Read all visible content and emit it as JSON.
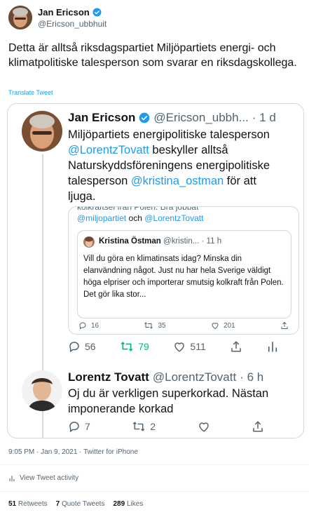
{
  "header": {
    "name": "Jan Ericson",
    "handle": "@Ericson_ubbhuit"
  },
  "tweet": {
    "text": "Detta är alltså riksdagspartiet Miljöpartiets energi- och klimatpolitiske talesperson som svarar en riksdagskollega.",
    "translate_label": "Translate Tweet"
  },
  "embed": {
    "author_name": "Jan Ericson",
    "author_handle": "@Ericson_ubbh...",
    "time": "· 1 d",
    "line1": "Miljöpartiets energipolitiske talesperson",
    "mention_lorentz": "@LorentzTovatt",
    "line2_rest": " beskyller alltså",
    "line3": "Naturskyddsföreningens energipolitiske",
    "line4_start": "talesperson ",
    "mention_kristina": "@kristina_ostman",
    "line4_rest": " för att",
    "line5": "ljuga.",
    "quote_cut_line": "kolkraftsel från Polen. Bra jobbat",
    "quote_mention_mp": "@miljopartiet",
    "quote_och": " och ",
    "quote_mention_lt": "@LorentzTovatt",
    "inner": {
      "name": "Kristina Östman",
      "handle": "@kristin...",
      "time": "· 11 h",
      "text": "Vill du göra en klimatinsats idag? Minska din elanvändning något. Just nu har hela Sverige väldigt höga elpriser och importerar smutsig kolkraft från Polen. Det gör lika stor...",
      "replies": "16",
      "retweets": "35",
      "likes": "201"
    },
    "actions": {
      "replies": "56",
      "retweets": "79",
      "likes": "511"
    },
    "reply": {
      "name": "Lorentz Tovatt",
      "handle": "@LorentzTovatt",
      "time": "· 6 h",
      "text": "Oj du är verkligen superkorkad. Nästan imponerande korkad",
      "replies": "7",
      "retweets": "2"
    }
  },
  "meta": {
    "timestamp": "9:05 PM · Jan 9, 2021 · Twitter for iPhone",
    "activity_label": "View Tweet activity"
  },
  "stats": {
    "retweets_count": "51",
    "retweets_label": "Retweets",
    "quotes_count": "7",
    "quotes_label": "Quote Tweets",
    "likes_count": "289",
    "likes_label": "Likes"
  },
  "colors": {
    "accent": "#1d9bf0",
    "retweet_active": "#00ba7c",
    "text_secondary": "#536471",
    "border": "#cfd9de"
  }
}
